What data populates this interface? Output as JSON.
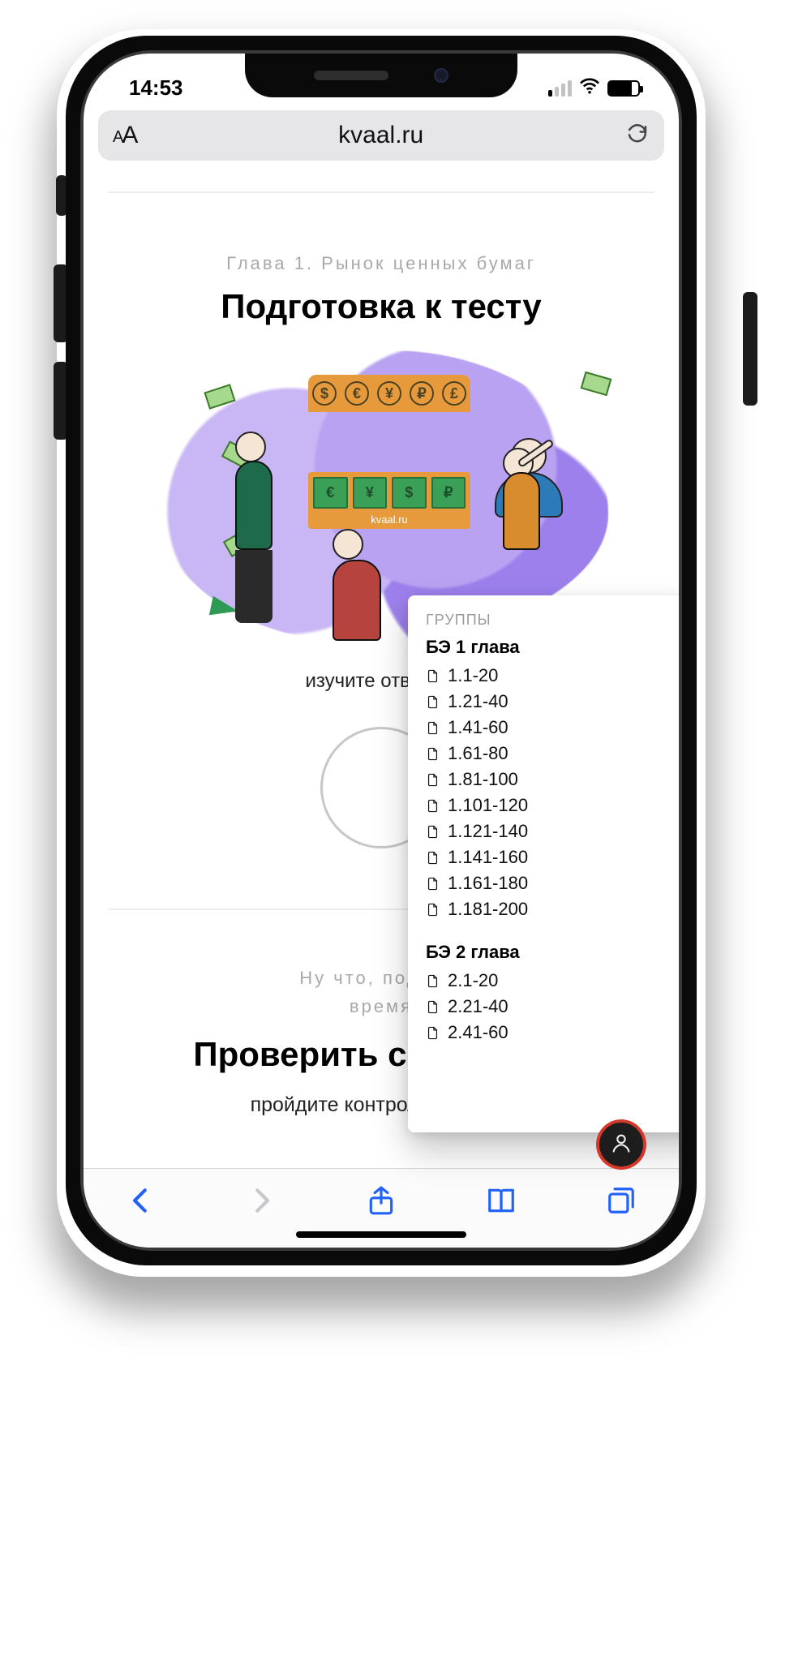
{
  "status": {
    "time": "14:53"
  },
  "url_bar": {
    "url": "kvaal.ru"
  },
  "hero": {
    "chapter_line": "Глава 1. Рынок ценных бумаг",
    "title": "Подготовка к тесту",
    "illus_brand": "kvaal.ru",
    "illus_tiles": [
      "€",
      "¥",
      "$",
      "₽"
    ],
    "illus_roof": [
      "$",
      "€",
      "¥",
      "₽",
      "£"
    ],
    "caption": "изучите ответы к"
  },
  "panel": {
    "label": "ГРУППЫ",
    "groups": [
      {
        "title": "БЭ 1 глава",
        "items": [
          "1.1-20",
          "1.21-40",
          "1.41-60",
          "1.61-80",
          "1.81-100",
          "1.101-120",
          "1.121-140",
          "1.141-160",
          "1.161-180",
          "1.181-200"
        ]
      },
      {
        "title": "БЭ 2 глава",
        "items": [
          "2.1-20",
          "2.21-40",
          "2.41-60"
        ]
      }
    ]
  },
  "section2": {
    "subtle_line1": "Ну что, подгото",
    "subtle_line2": "время",
    "title": "Проверить свои силы",
    "caption": "пройдите контрольный тест"
  }
}
